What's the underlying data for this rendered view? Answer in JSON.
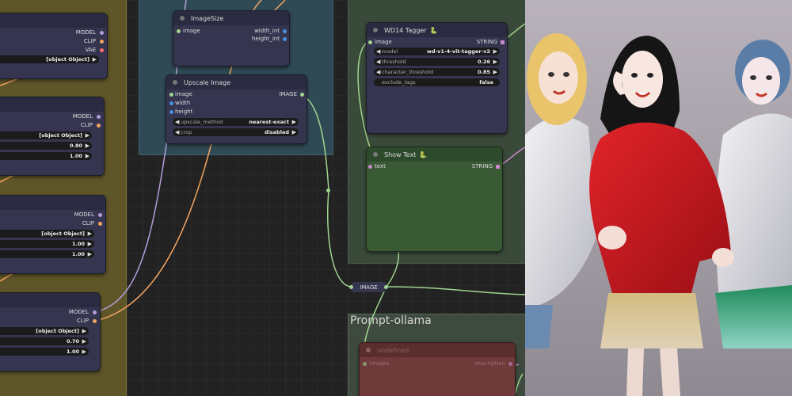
{
  "groups": {
    "prompt_ollama": "Prompt-ollama"
  },
  "left_nodes": [
    {
      "outputs": [
        "MODEL",
        "CLIP",
        "VAE"
      ],
      "widgets": [
        "[object Object]"
      ]
    },
    {
      "outputs": [
        "MODEL",
        "CLIP"
      ],
      "widgets": [
        "[object Object]",
        "0.80",
        "1.00"
      ]
    },
    {
      "outputs": [
        "MODEL",
        "CLIP"
      ],
      "widgets": [
        "[object Object]",
        "1.00",
        "1.00"
      ]
    },
    {
      "outputs": [
        "MODEL",
        "CLIP"
      ],
      "widgets": [
        "[object Object]",
        "0.70",
        "1.00"
      ]
    }
  ],
  "image_size": {
    "title": "ImageSize",
    "input": "image",
    "outputs": [
      "width_int",
      "height_int"
    ]
  },
  "upscale": {
    "title": "Upscale Image",
    "inputs": [
      "image",
      "width",
      "height"
    ],
    "output": "IMAGE",
    "widgets": [
      {
        "label": "upscale_method",
        "value": "nearest-exact"
      },
      {
        "label": "crop",
        "value": "disabled"
      }
    ]
  },
  "tagger": {
    "title": "WD14 Tagger",
    "input": "image",
    "output": "STRING",
    "widgets": [
      {
        "label": "model",
        "value": "wd-v1-4-vit-tagger-v2",
        "arrows": true
      },
      {
        "label": "threshold",
        "value": "0.26",
        "arrows": true
      },
      {
        "label": "character_threshold",
        "value": "0.85",
        "arrows": true
      },
      {
        "label": "exclude_tags",
        "value": "false",
        "arrows": false
      }
    ]
  },
  "show_text": {
    "title": "Show Text",
    "input": "text",
    "output": "STRING"
  },
  "reroute": {
    "label": "IMAGE"
  },
  "undefined_node": {
    "title": "undefined",
    "input": "images",
    "output": "description"
  },
  "colors": {
    "image_port": "#a1d58f",
    "model_port": "#b39ddb",
    "clip_port": "#f4a460",
    "int_port": "#4a90e2",
    "string_port": "#cc88cc"
  }
}
